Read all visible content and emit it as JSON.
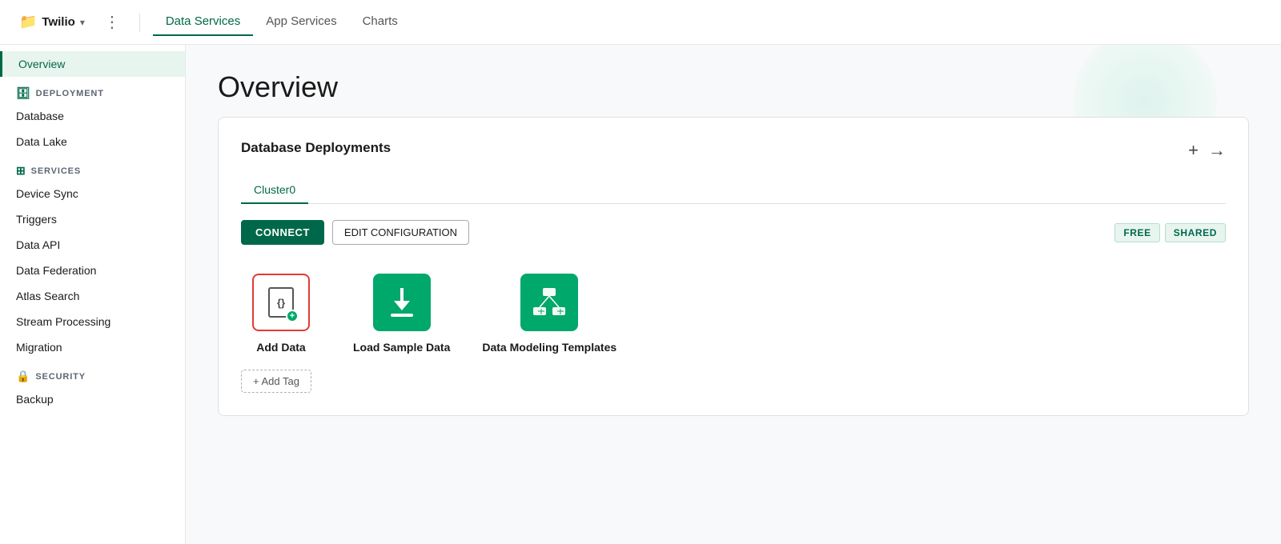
{
  "topNav": {
    "brand": "Twilio",
    "dotsLabel": "⋮",
    "tabs": [
      {
        "id": "data-services",
        "label": "Data Services",
        "active": true
      },
      {
        "id": "app-services",
        "label": "App Services",
        "active": false
      },
      {
        "id": "charts",
        "label": "Charts",
        "active": false
      }
    ]
  },
  "sidebar": {
    "overview": "Overview",
    "sections": [
      {
        "id": "deployment",
        "label": "DEPLOYMENT",
        "icon": "database",
        "items": [
          {
            "id": "database",
            "label": "Database"
          },
          {
            "id": "data-lake",
            "label": "Data Lake"
          }
        ]
      },
      {
        "id": "services",
        "label": "SERVICES",
        "icon": "grid",
        "items": [
          {
            "id": "device-sync",
            "label": "Device Sync"
          },
          {
            "id": "triggers",
            "label": "Triggers"
          },
          {
            "id": "data-api",
            "label": "Data API"
          },
          {
            "id": "data-federation",
            "label": "Data Federation"
          },
          {
            "id": "atlas-search",
            "label": "Atlas Search"
          },
          {
            "id": "stream-processing",
            "label": "Stream Processing"
          },
          {
            "id": "migration",
            "label": "Migration"
          }
        ]
      },
      {
        "id": "security",
        "label": "SECURITY",
        "icon": "lock",
        "items": [
          {
            "id": "backup",
            "label": "Backup"
          }
        ]
      }
    ]
  },
  "main": {
    "pageTitle": "Overview",
    "card": {
      "title": "Database Deployments",
      "addIcon": "+",
      "arrowIcon": "→",
      "tabs": [
        {
          "id": "cluster0",
          "label": "Cluster0",
          "active": true
        }
      ],
      "buttons": {
        "connect": "CONNECT",
        "editConfig": "EDIT CONFIGURATION"
      },
      "badges": [
        {
          "id": "free",
          "label": "FREE"
        },
        {
          "id": "shared",
          "label": "SHARED"
        }
      ],
      "tiles": [
        {
          "id": "add-data",
          "label": "Add Data",
          "selected": true,
          "type": "outlined"
        },
        {
          "id": "load-sample",
          "label": "Load Sample Data",
          "type": "green"
        },
        {
          "id": "data-modeling",
          "label": "Data Modeling Templates",
          "type": "green"
        }
      ],
      "addTagLabel": "+ Add Tag"
    }
  }
}
